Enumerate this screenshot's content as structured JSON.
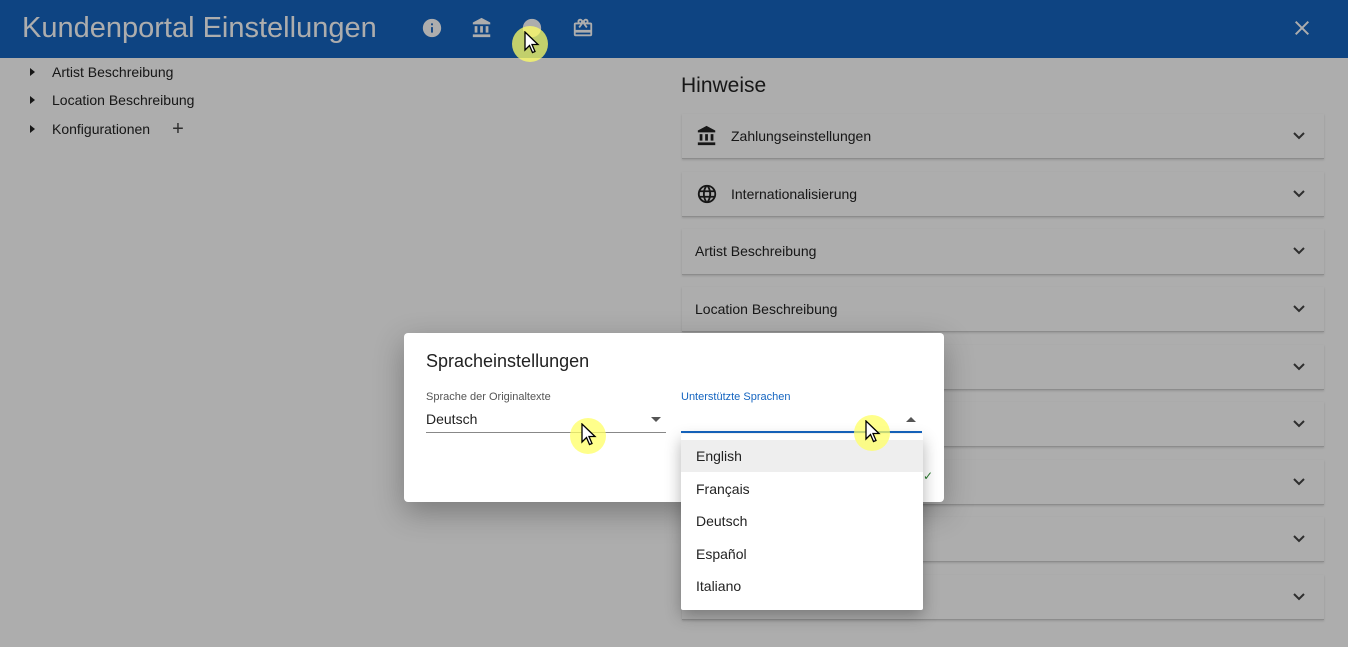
{
  "app": {
    "title": "Kundenportal Einstellungen"
  },
  "topbar_icons": [
    "info-icon",
    "bank-icon",
    "globe-icon",
    "gift-icon"
  ],
  "tree": {
    "items": [
      {
        "label": "Artist Beschreibung"
      },
      {
        "label": "Location Beschreibung"
      },
      {
        "label": "Konfigurationen"
      }
    ],
    "add_label": "+"
  },
  "hinweise": {
    "title": "Hinweise",
    "sections": [
      {
        "label": "Zahlungseinstellungen",
        "icon": "bank-icon"
      },
      {
        "label": "Internationalisierung",
        "icon": "globe-icon"
      },
      {
        "label": "Artist Beschreibung"
      },
      {
        "label": "Location Beschreibung"
      },
      {
        "label": ""
      },
      {
        "label": ""
      },
      {
        "label": ""
      },
      {
        "label": ""
      },
      {
        "label": ""
      }
    ]
  },
  "dialog": {
    "title": "Spracheinstellungen",
    "original_language": {
      "label": "Sprache der Originaltexte",
      "value": "Deutsch"
    },
    "supported_languages": {
      "label": "Unterstützte Sprachen",
      "value": ""
    },
    "check_mark": "✓"
  },
  "dropdown": {
    "options": [
      "English",
      "Français",
      "Deutsch",
      "Español",
      "Italiano"
    ],
    "highlighted_index": 0
  },
  "colors": {
    "accent": "#1565c0",
    "overlay": "rgba(0,0,0,0.32)",
    "cursor_highlight": "#ffff64"
  }
}
